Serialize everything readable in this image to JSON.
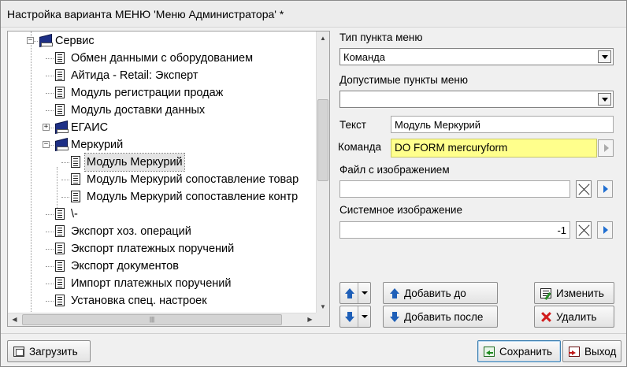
{
  "window": {
    "title": "Настройка варианта МЕНЮ 'Меню Администратора' *"
  },
  "tree": {
    "nodes": [
      {
        "label": "Сервис",
        "icon": "book-icon",
        "expander": "−"
      },
      {
        "label": "Обмен данными с оборудованием",
        "icon": "document-icon"
      },
      {
        "label": "Айтида - Retail: Эксперт",
        "icon": "document-icon"
      },
      {
        "label": "Модуль регистрации продаж",
        "icon": "document-icon"
      },
      {
        "label": "Модуль доставки данных",
        "icon": "document-icon"
      },
      {
        "label": "ЕГАИС",
        "icon": "book-icon",
        "expander": "+"
      },
      {
        "label": "Меркурий",
        "icon": "book-icon",
        "expander": "−"
      },
      {
        "label": "Модуль Меркурий",
        "icon": "document-icon",
        "selected": true
      },
      {
        "label": "Модуль Меркурий сопоставление товар",
        "icon": "document-icon"
      },
      {
        "label": "Модуль Меркурий сопоставление контр",
        "icon": "document-icon"
      },
      {
        "label": "\\-",
        "icon": "document-icon"
      },
      {
        "label": "Экспорт хоз. операций",
        "icon": "document-icon"
      },
      {
        "label": "Экспорт платежных поручений",
        "icon": "document-icon"
      },
      {
        "label": "Экспорт документов",
        "icon": "document-icon"
      },
      {
        "label": "Импорт платежных поручений",
        "icon": "document-icon"
      },
      {
        "label": "Установка спец. настроек",
        "icon": "document-icon"
      }
    ]
  },
  "form": {
    "menu_item_type": {
      "label": "Тип пункта меню",
      "value": "Команда"
    },
    "allowed_items": {
      "label": "Допустимые пункты меню",
      "value": ""
    },
    "text": {
      "label": "Текст",
      "value": "Модуль Меркурий"
    },
    "command": {
      "label": "Команда",
      "value": "DO FORM mercuryform"
    },
    "image_file": {
      "label": "Файл с изображением",
      "value": ""
    },
    "system_image": {
      "label": "Системное изображение",
      "value": "-1"
    }
  },
  "buttons": {
    "add_before": "Добавить до",
    "add_after": "Добавить после",
    "edit": "Изменить",
    "delete": "Удалить",
    "load": "Загрузить",
    "save": "Сохранить",
    "exit": "Выход"
  },
  "colors": {
    "command_highlight": "#ffff8c",
    "arrow_accent": "#1e5fb8"
  }
}
